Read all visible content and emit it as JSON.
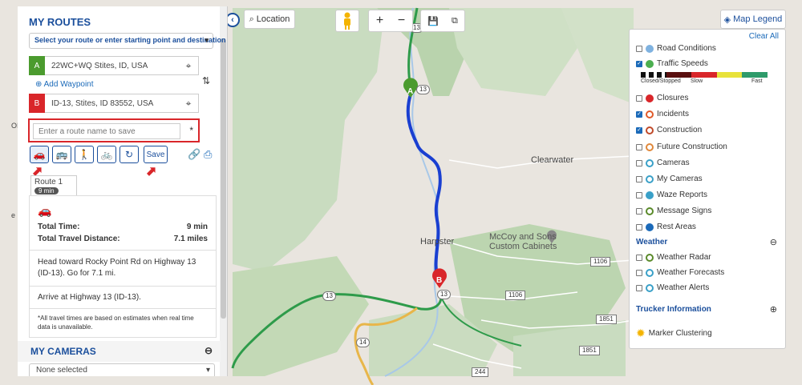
{
  "panel": {
    "title": "MY ROUTES",
    "select_text": "Select your route or enter starting point and destination",
    "waypoint_a_label": "A",
    "waypoint_a_value": "22WC+WQ Stites, ID, USA",
    "add_waypoint": "Add Waypoint",
    "waypoint_b_label": "B",
    "waypoint_b_value": "ID-13, Stites, ID 83552, USA",
    "route_name_placeholder": "Enter a route name to save",
    "required_mark": "*",
    "save_label": "Save",
    "route_tab_label": "Route 1",
    "route_tab_time": "9 min",
    "total_time_label": "Total Time:",
    "total_time_value": "9 min",
    "total_distance_label": "Total Travel Distance:",
    "total_distance_value": "7.1 miles",
    "step1": "Head toward Rocky Point Rd on Highway 13 (ID-13). Go for 7.1 mi.",
    "step2": "Arrive at Highway 13 (ID-13).",
    "note": "*All travel times are based on estimates when real time data is unavailable.",
    "cameras_title": "MY CAMERAS",
    "cameras_select": "None selected"
  },
  "map_controls": {
    "location_label": "Location",
    "zoom_in": "+",
    "zoom_out": "−",
    "legend_label": "Map Legend"
  },
  "map_labels": {
    "clearwater": "Clearwater",
    "harpster": "Harpster",
    "mccoy": "McCoy and Sons Custom Cabinets",
    "marker_a": "A",
    "marker_b": "B",
    "hwy13": "13",
    "hwy14": "14",
    "r1106": "1106",
    "r1851": "1851",
    "r244": "244",
    "edge_left_1": "OI",
    "edge_left_2": "e"
  },
  "legend": {
    "clear_all": "Clear All",
    "road_conditions": "Road Conditions",
    "traffic_speeds": "Traffic Speeds",
    "closed_stopped": "Closed/Stopped",
    "slow": "Slow",
    "fast": "Fast",
    "closures": "Closures",
    "incidents": "Incidents",
    "construction": "Construction",
    "future_construction": "Future Construction",
    "cameras": "Cameras",
    "my_cameras": "My Cameras",
    "waze_reports": "Waze Reports",
    "message_signs": "Message Signs",
    "rest_areas": "Rest Areas",
    "weather": "Weather",
    "weather_radar": "Weather Radar",
    "weather_forecasts": "Weather Forecasts",
    "weather_alerts": "Weather Alerts",
    "trucker_info": "Trucker Information",
    "marker_clustering": "Marker Clustering",
    "minus": "⊖",
    "plus": "⊕"
  },
  "colors": {
    "brand": "#1b4f9c",
    "route": "#1a3fd1",
    "highlight": "#d9262a",
    "marker_a": "#4b9b2e",
    "marker_b": "#d9262a"
  }
}
